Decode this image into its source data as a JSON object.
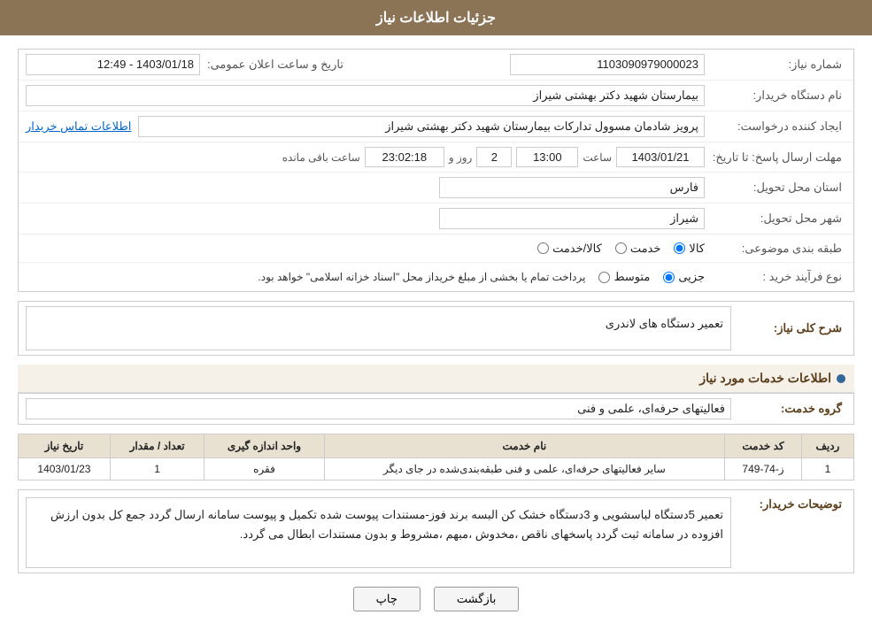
{
  "header": {
    "title": "جزئیات اطلاعات نیاز"
  },
  "fields": {
    "need_number_label": "شماره نیاز:",
    "need_number_value": "1103090979000023",
    "announce_date_label": "تاریخ و ساعت اعلان عمومی:",
    "announce_date_value": "1403/01/18 - 12:49",
    "buyer_org_label": "نام دستگاه خریدار:",
    "buyer_org_value": "بیمارستان شهید دکتر بهشتی شیراز",
    "creator_label": "ایجاد کننده درخواست:",
    "creator_value": "پرویز شادمان مسوول تدارکات بیمارستان شهید دکتر بهشتی شیراز",
    "contact_link": "اطلاعات تماس خریدار",
    "response_deadline_label": "مهلت ارسال پاسخ: تا تاریخ:",
    "response_date": "1403/01/21",
    "response_time_label": "ساعت",
    "response_time": "13:00",
    "response_days_label": "روز و",
    "response_days": "2",
    "response_remaining_label": "ساعت باقی مانده",
    "response_remaining": "23:02:18",
    "province_label": "استان محل تحویل:",
    "province_value": "فارس",
    "city_label": "شهر محل تحویل:",
    "city_value": "شیراز",
    "category_label": "طبقه بندی موضوعی:",
    "category_options": [
      "کالا",
      "خدمت",
      "کالا/خدمت"
    ],
    "category_selected": "کالا",
    "purchase_type_label": "نوع فرآیند خرید :",
    "purchase_type_options": [
      "جزیی",
      "متوسط"
    ],
    "purchase_type_note": "پرداخت تمام یا بخشی از مبلغ خریداز محل \"اسناد خزانه اسلامی\" خواهد بود.",
    "need_desc_label": "شرح کلی نیاز:",
    "need_desc_value": "تعمیر دستگاه های لاندری",
    "services_header": "اطلاعات خدمات مورد نیاز",
    "service_group_label": "گروه خدمت:",
    "service_group_value": "فعالیتهای حرفه‌ای، علمی و فنی",
    "table": {
      "headers": [
        "ردیف",
        "کد خدمت",
        "نام خدمت",
        "واحد اندازه گیری",
        "تعداد / مقدار",
        "تاریخ نیاز"
      ],
      "rows": [
        {
          "row_num": "1",
          "service_code": "ز-74-749",
          "service_name": "سایر فعالیتهای حرفه‌ای، علمی و فنی طبقه‌بندی‌شده در جای دیگر",
          "unit": "فقره",
          "quantity": "1",
          "date": "1403/01/23"
        }
      ]
    },
    "buyer_desc_label": "توضیحات خریدار:",
    "buyer_desc_value": "تعمیر 5دستگاه لباسشویی و 3دستگاه خشک کن البسه برند فوز-مستندات پیوست شده تکمیل و پیوست سامانه ارسال گردد جمع کل بدون ارزش افزوده در سامانه ثبت گردد پاسخهای ناقص ،مخدوش ،مبهم ،مشروط و بدون مستندات ابطال می گردد.",
    "buttons": {
      "print": "چاپ",
      "back": "بازگشت"
    }
  }
}
